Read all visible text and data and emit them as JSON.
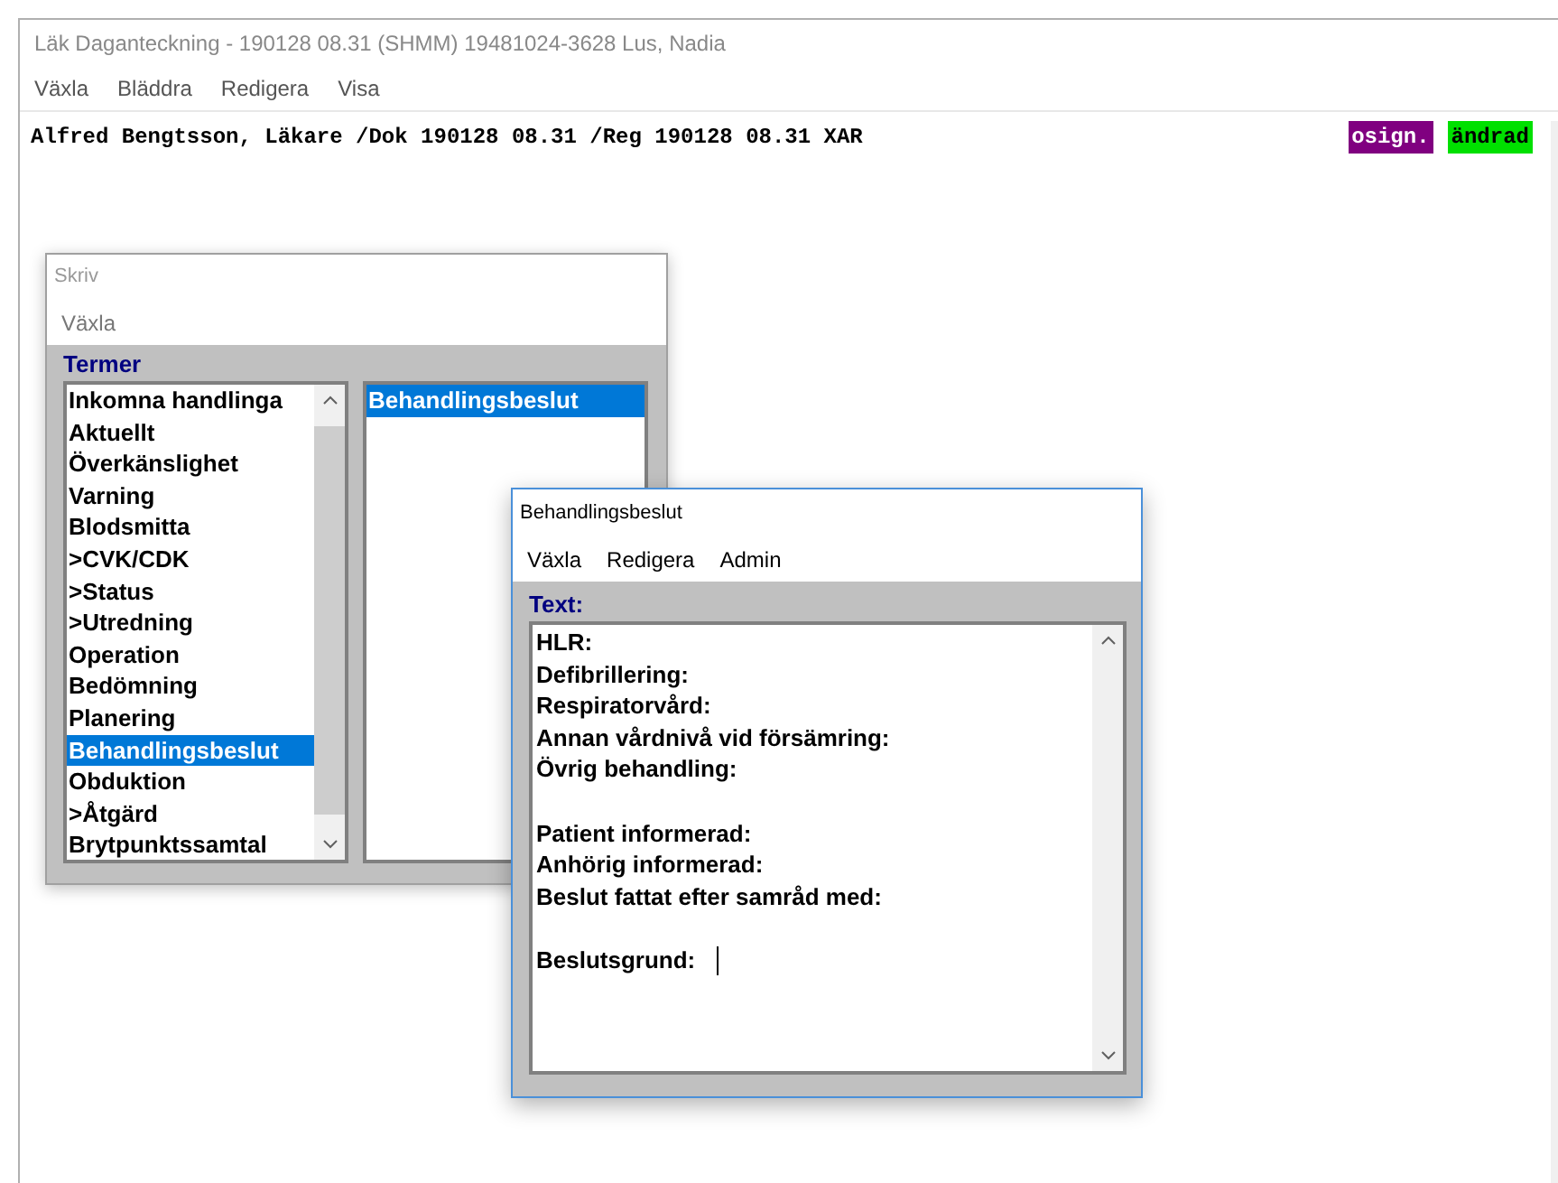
{
  "window": {
    "title": "Läk Daganteckning - 190128 08.31  (SHMM)  19481024-3628  Lus, Nadia"
  },
  "menu": [
    "Växla",
    "Bläddra",
    "Redigera",
    "Visa"
  ],
  "header": {
    "text": "Alfred Bengtsson, Läkare /Dok 190128 08.31 /Reg 190128 08.31 XAR",
    "badges": [
      {
        "label": "osign.",
        "color": "#800080"
      },
      {
        "label": "ändrad",
        "color": "#00e000"
      }
    ]
  },
  "skriv_window": {
    "title": "Skriv",
    "menu": [
      "Växla"
    ],
    "section_label": "Termer",
    "terms": [
      {
        "label": "Inkomna handlinga",
        "selected": false
      },
      {
        "label": "Aktuellt",
        "selected": false
      },
      {
        "label": "Överkänslighet",
        "selected": false
      },
      {
        "label": "Varning",
        "selected": false
      },
      {
        "label": "Blodsmitta",
        "selected": false
      },
      {
        "label": ">CVK/CDK",
        "selected": false
      },
      {
        "label": ">Status",
        "selected": false
      },
      {
        "label": ">Utredning",
        "selected": false
      },
      {
        "label": "Operation",
        "selected": false
      },
      {
        "label": "Bedömning",
        "selected": false
      },
      {
        "label": "Planering",
        "selected": false
      },
      {
        "label": "Behandlingsbeslut",
        "selected": true
      },
      {
        "label": "Obduktion",
        "selected": false
      },
      {
        "label": ">Åtgärd",
        "selected": false
      },
      {
        "label": "Brytpunktssamtal",
        "selected": false
      }
    ],
    "subterms": [
      {
        "label": "Behandlingsbeslut",
        "selected": true
      }
    ]
  },
  "text_window": {
    "title": "Behandlingsbeslut",
    "menu": [
      "Växla",
      "Redigera",
      "Admin"
    ],
    "section_label": "Text:",
    "paragraphs": [
      [
        "HLR:",
        "Defibrillering:",
        "Respiratorvård:",
        "Annan vårdnivå vid försämring:",
        "Övrig behandling:"
      ],
      [
        "Patient informerad:",
        "Anhörig informerad:",
        "Beslut fattat efter samråd med:"
      ],
      [
        "Beslutsgrund:"
      ]
    ]
  }
}
